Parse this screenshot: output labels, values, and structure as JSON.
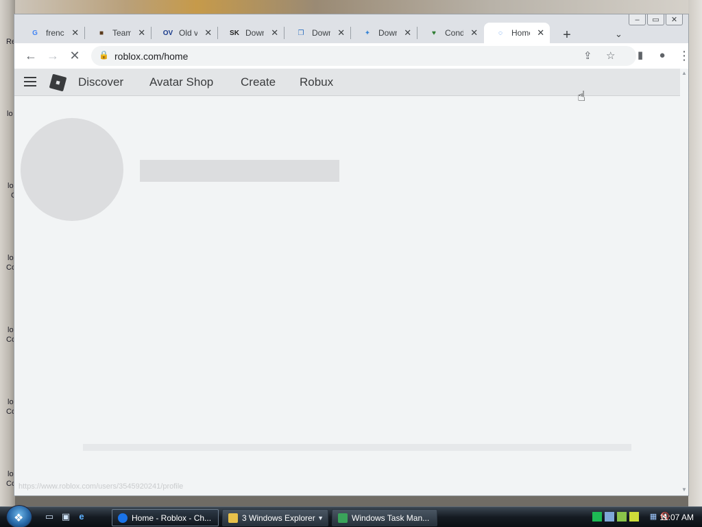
{
  "desktop": {
    "labels": [
      "Re",
      "lo",
      "lo",
      "C",
      "lo",
      "Co",
      "lo",
      "Co",
      "lo",
      "Co",
      "lo",
      "Co"
    ]
  },
  "window_controls": {
    "minimize": "–",
    "maximize": "▭",
    "close": "✕"
  },
  "tabs": [
    {
      "title": "french",
      "favicon": "google-icon",
      "fav_glyph": "G",
      "fav_color": "#4285f4",
      "active": false
    },
    {
      "title": "Team",
      "favicon": "minecraft-block-icon",
      "fav_glyph": "■",
      "fav_color": "#5b3b1c",
      "active": false
    },
    {
      "title": "Old ve",
      "favicon": "ov-icon",
      "fav_glyph": "OV",
      "fav_color": "#1a3b8c",
      "active": false
    },
    {
      "title": "Down",
      "favicon": "sk-icon",
      "fav_glyph": "SK",
      "fav_color": "#222222",
      "active": false
    },
    {
      "title": "Down",
      "favicon": "document-icon",
      "fav_glyph": "❐",
      "fav_color": "#2c6fbf",
      "active": false
    },
    {
      "title": "Down",
      "favicon": "butterfly-icon",
      "fav_glyph": "✦",
      "fav_color": "#3a86d6",
      "active": false
    },
    {
      "title": "Conde",
      "favicon": "heart-icon",
      "fav_glyph": "♥",
      "fav_color": "#2e7d32",
      "active": false
    },
    {
      "title": "Home",
      "favicon": "loading-spinner-icon",
      "fav_glyph": "◌",
      "fav_color": "#1a73e8",
      "active": true
    }
  ],
  "tab_close_glyph": "✕",
  "new_tab_glyph": "+",
  "tab_search_glyph": "⌄",
  "toolbar": {
    "back_glyph": "←",
    "forward_glyph": "→",
    "stop_glyph": "✕",
    "lock_glyph": "🔒",
    "url": "roblox.com/home",
    "share_glyph": "⇪",
    "star_glyph": "☆",
    "sidepanel_glyph": "▮",
    "profile_glyph": "●",
    "menu_glyph": "⋮"
  },
  "roblox_nav": {
    "links": [
      "Discover",
      "Avatar Shop",
      "Create",
      "Robux"
    ]
  },
  "status_url": "https://www.roblox.com/users/3545920241/profile",
  "taskbar": {
    "start_glyph": "❖",
    "quick_launch": [
      "show-desktop-icon",
      "switch-windows-icon",
      "internet-explorer-icon"
    ],
    "buttons": [
      {
        "label": "Home - Roblox - Ch...",
        "icon_color": "#1a73e8",
        "active": true
      },
      {
        "label": "3 Windows Explorer",
        "icon_color": "#e8c14a",
        "active": false
      },
      {
        "label": "Windows Task Man...",
        "icon_color": "#3aa35a",
        "active": false
      }
    ],
    "dropdown_glyph": "▼",
    "clock": "11:07 AM",
    "volume_glyph": "🔇"
  }
}
